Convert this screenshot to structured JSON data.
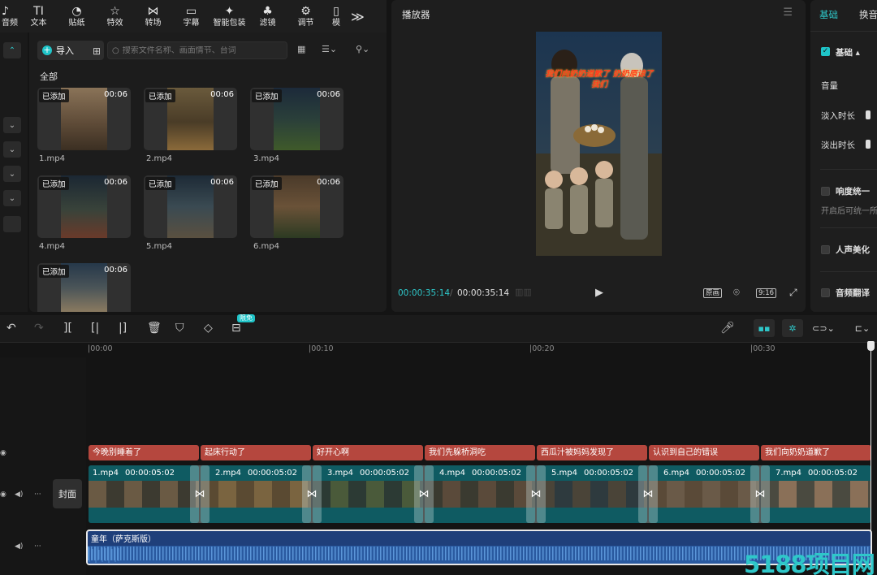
{
  "toolbar": {
    "items": [
      {
        "icon": "tiktok-note-icon",
        "glyph": "♪",
        "label": "音频"
      },
      {
        "icon": "text-icon",
        "glyph": "TI",
        "label": "文本"
      },
      {
        "icon": "sticker-icon",
        "glyph": "◔",
        "label": "贴纸"
      },
      {
        "icon": "effects-icon",
        "glyph": "☆",
        "label": "特效"
      },
      {
        "icon": "transition-icon",
        "glyph": "⋈",
        "label": "转场"
      },
      {
        "icon": "caption-icon",
        "glyph": "▭",
        "label": "字幕"
      },
      {
        "icon": "smart-pack-icon",
        "glyph": "✦",
        "label": "智能包装"
      },
      {
        "icon": "filter-icon",
        "glyph": "♣",
        "label": "滤镜"
      },
      {
        "icon": "adjust-icon",
        "glyph": "⚙",
        "label": "调节"
      },
      {
        "icon": "template-icon",
        "glyph": "▯",
        "label": "模"
      }
    ],
    "more": "≫"
  },
  "media": {
    "import_label": "导入",
    "search_placeholder": "搜索文件名称、画面情节、台词",
    "all_label": "全部",
    "added_tag": "已添加",
    "items": [
      {
        "name": "1.mp4",
        "duration": "00:06"
      },
      {
        "name": "2.mp4",
        "duration": "00:06"
      },
      {
        "name": "3.mp4",
        "duration": "00:06"
      },
      {
        "name": "4.mp4",
        "duration": "00:06"
      },
      {
        "name": "5.mp4",
        "duration": "00:06"
      },
      {
        "name": "6.mp4",
        "duration": "00:06"
      },
      {
        "name": "",
        "duration": "00:06"
      }
    ]
  },
  "player": {
    "title": "播放器",
    "caption": "我们向奶奶道歉了 奶奶原谅了我们",
    "current_time": "00:00:35:14",
    "separator": "/",
    "total_time": "00:00:35:14",
    "original_label": "原画",
    "ratio_label": "9:16"
  },
  "right_panel": {
    "tabs": [
      "基础",
      "换音"
    ],
    "basic_label": "基础",
    "volume_label": "音量",
    "fade_in_label": "淡入时长",
    "fade_out_label": "淡出时长",
    "loudness_label": "响度统一",
    "loudness_desc": "开启后可统一所",
    "voice_beauty_label": "人声美化",
    "audio_translate_label": "音频翻译"
  },
  "timeline": {
    "limited_badge": "限免",
    "ruler": [
      "|00:00",
      "|00:10",
      "|00:20",
      "|00:30"
    ],
    "cover_label": "封面",
    "subtitles": [
      "今晚别睡着了",
      "起床行动了",
      "好开心啊",
      "我们先躲桥洞吃",
      "西瓜汁被妈妈发现了",
      "认识到自己的错误",
      "我们向奶奶道歉了"
    ],
    "clips": [
      {
        "name": "1.mp4",
        "duration": "00:00:05:02"
      },
      {
        "name": "2.mp4",
        "duration": "00:00:05:02"
      },
      {
        "name": "3.mp4",
        "duration": "00:00:05:02"
      },
      {
        "name": "4.mp4",
        "duration": "00:00:05:02"
      },
      {
        "name": "5.mp4",
        "duration": "00:00:05:02"
      },
      {
        "name": "6.mp4",
        "duration": "00:00:05:02"
      },
      {
        "name": "7.mp4",
        "duration": "00:00:05:02"
      }
    ],
    "audio_label": "童年（萨克斯版）"
  },
  "watermark": "5188项目网",
  "colors": {
    "accent": "#2ec7c9",
    "subtitle": "#b5473e",
    "clip": "#0f5b62",
    "audio": "#1f3f7a"
  }
}
